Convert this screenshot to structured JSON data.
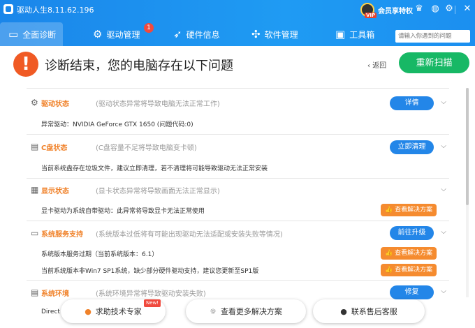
{
  "window": {
    "title": "驱动人生8.11.62.196"
  },
  "account": {
    "member_label": "会员享特权",
    "vip_tag": "VIP"
  },
  "nav": {
    "tabs": [
      {
        "label": "全面诊断"
      },
      {
        "label": "驱动管理"
      },
      {
        "label": "硬件信息"
      },
      {
        "label": "软件管理"
      },
      {
        "label": "工具箱"
      }
    ],
    "badge_count": "1",
    "search_placeholder": "请输入你遇到的问题"
  },
  "diagnosis": {
    "title": "诊断结束，您的电脑存在以下问题",
    "back_label": "返回",
    "rescan_label": "重新扫描"
  },
  "sections": [
    {
      "title": "驱动状态",
      "desc": "(驱动状态异常将导致电脑无法正常工作)",
      "action": "详情",
      "details": [
        "异常驱动：NVIDIA GeForce GTX 1650 (问题代码:0)"
      ]
    },
    {
      "title": "C盘状态",
      "desc": "(C盘容量不足将导致电脑变卡顿)",
      "action": "立即清理",
      "details": [
        "当前系统盘存在垃圾文件，建议立即清理，若不清理将可能导致驱动无法正常安装"
      ]
    },
    {
      "title": "显示状态",
      "desc": "(显卡状态异常将导致画面无法正常显示)",
      "details": [
        "显卡驱动为系统自带驱动：此异常将导致显卡无法正常使用"
      ]
    },
    {
      "title": "系统服务支持",
      "desc": "(系统版本过低将有可能出现驱动无法适配或安装失败等情况)",
      "action": "前往升级",
      "details": [
        "系统版本服务过期（当前系统版本：6.1）",
        "当前系统版本非Win7 SP1系统，缺少部分硬件驱动支持，建议您更新至SP1版"
      ]
    },
    {
      "title": "系统环境",
      "desc": "(系统环境异常将导致驱动安装失败)",
      "action": "修复",
      "details": [
        "Direct"
      ]
    }
  ],
  "solution_label": "查看解决方案",
  "bottom": {
    "expert_label": "求助技术专家",
    "new_tag": "New!",
    "more_label": "查看更多解决方案",
    "contact_label": "联系售后客服"
  },
  "colors": {
    "brand_blue": "#1a86ea",
    "orange": "#f0822a",
    "green": "#17b865",
    "alert": "#f05a24"
  }
}
